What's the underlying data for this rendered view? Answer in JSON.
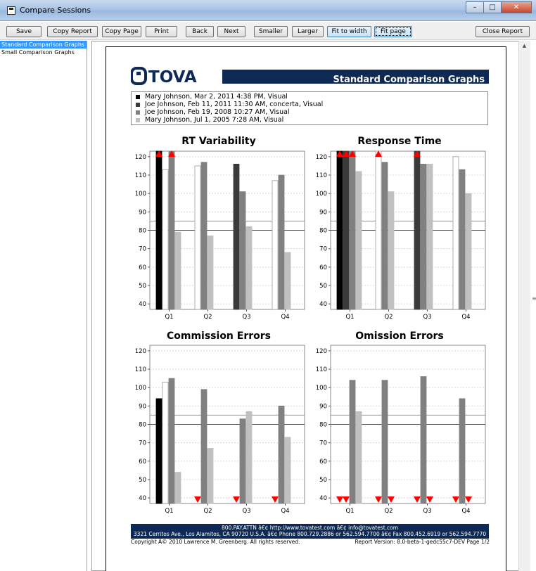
{
  "window": {
    "title": "Compare Sessions",
    "controls": {
      "minimize": "–",
      "maximize": "□",
      "close": "✕"
    }
  },
  "toolbar": {
    "buttons": [
      {
        "label": "Save"
      },
      {
        "label": "Copy Report"
      },
      {
        "label": "Copy Page"
      },
      {
        "label": "Print"
      },
      {
        "label": "Back"
      },
      {
        "label": "Next"
      },
      {
        "label": "Smaller"
      },
      {
        "label": "Larger"
      },
      {
        "label": "Fit to width"
      },
      {
        "label": "Fit page"
      },
      {
        "label": "Close Report"
      }
    ]
  },
  "sidebar": {
    "items": [
      {
        "label": "Standard Comparison Graphs",
        "selected": true
      },
      {
        "label": "Small Comparison Graphs",
        "selected": false
      }
    ]
  },
  "report": {
    "brand": "TOVA",
    "title": "Standard Comparison Graphs",
    "legend": [
      {
        "label": "Mary Johnson, Mar 2, 2011 4:38 PM, Visual",
        "color": "#000000"
      },
      {
        "label": "Joe Johnson, Feb 11, 2011 11:30 AM, concerta, Visual",
        "color": "#3a3a3a"
      },
      {
        "label": "Joe Johnson, Feb 19, 2008 10:27 AM, Visual",
        "color": "#808080"
      },
      {
        "label": "Mary Johnson, Jul 1, 2005 7:28 AM, Visual",
        "color": "#c0c0c0"
      }
    ],
    "footer": {
      "line1": "800.PAY.ATTN â€¢ http://www.tovatest.com â€¢ info@tovatest.com",
      "line2": "3321 Cerritos Ave., Los Alamitos, CA 90720 U.S.A. â€¢ Phone 800.729.2886 or 562.594.7700 â€¢ Fax 800.452.6919 or 562.594.7770",
      "copyright": "Copyright Â© 2010 Lawrence M. Greenberg. All rights reserved.",
      "version": "Report Version: 8.0-beta-1-gedc55c7-DEV   Page 1/2"
    }
  },
  "chart_data": [
    {
      "type": "bar",
      "title": "RT Variability",
      "categories": [
        "Q1",
        "Q2",
        "Q3",
        "Q4"
      ],
      "ylim": [
        37,
        123
      ],
      "yticks": [
        40,
        50,
        60,
        70,
        80,
        90,
        100,
        110,
        120
      ],
      "reference_lines": [
        80,
        85
      ],
      "series": [
        {
          "color": "#000000",
          "values": [
            123,
            null,
            null,
            null
          ],
          "overflow": [
            true,
            false,
            false,
            false
          ]
        },
        {
          "color": "#ffffff",
          "values": [
            113,
            115,
            null,
            107
          ],
          "overflow": [
            false,
            false,
            false,
            false
          ]
        },
        {
          "color": "#3a3a3a",
          "values": [
            null,
            null,
            116,
            null
          ],
          "overflow": [
            false,
            false,
            false,
            false
          ]
        },
        {
          "color": "#808080",
          "values": [
            123,
            117,
            101,
            110
          ],
          "overflow": [
            true,
            false,
            false,
            false
          ]
        },
        {
          "color": "#c0c0c0",
          "values": [
            79,
            77,
            82,
            68
          ],
          "overflow": [
            false,
            false,
            false,
            false
          ]
        }
      ]
    },
    {
      "type": "bar",
      "title": "Response Time",
      "categories": [
        "Q1",
        "Q2",
        "Q3",
        "Q4"
      ],
      "ylim": [
        37,
        123
      ],
      "yticks": [
        40,
        50,
        60,
        70,
        80,
        90,
        100,
        110,
        120
      ],
      "reference_lines": [
        80,
        85
      ],
      "series": [
        {
          "color": "#000000",
          "values": [
            123,
            null,
            null,
            null
          ],
          "overflow": [
            true,
            false,
            false,
            false
          ]
        },
        {
          "color": "#ffffff",
          "values": [
            null,
            123,
            null,
            120
          ],
          "overflow": [
            false,
            true,
            false,
            false
          ]
        },
        {
          "color": "#3a3a3a",
          "values": [
            123,
            null,
            123,
            null
          ],
          "overflow": [
            true,
            false,
            true,
            false
          ]
        },
        {
          "color": "#808080",
          "values": [
            123,
            117,
            116,
            113
          ],
          "overflow": [
            true,
            false,
            false,
            false
          ]
        },
        {
          "color": "#c0c0c0",
          "values": [
            112,
            101,
            116,
            100
          ],
          "overflow": [
            false,
            false,
            false,
            false
          ]
        }
      ]
    },
    {
      "type": "bar",
      "title": "Commission Errors",
      "categories": [
        "Q1",
        "Q2",
        "Q3",
        "Q4"
      ],
      "ylim": [
        37,
        123
      ],
      "yticks": [
        40,
        50,
        60,
        70,
        80,
        90,
        100,
        110,
        120
      ],
      "reference_lines": [
        80,
        85
      ],
      "series": [
        {
          "color": "#000000",
          "values": [
            94,
            null,
            null,
            null
          ],
          "underflow": [
            false,
            false,
            false,
            false
          ]
        },
        {
          "color": "#ffffff",
          "values": [
            103,
            null,
            null,
            null
          ],
          "underflow": [
            false,
            false,
            false,
            false
          ]
        },
        {
          "color": "#3a3a3a",
          "values": [
            null,
            37,
            37,
            37
          ],
          "underflow": [
            false,
            true,
            true,
            true
          ]
        },
        {
          "color": "#808080",
          "values": [
            105,
            99,
            83,
            90
          ],
          "underflow": [
            false,
            false,
            false,
            false
          ]
        },
        {
          "color": "#c0c0c0",
          "values": [
            54,
            67,
            87,
            73
          ],
          "underflow": [
            false,
            false,
            false,
            false
          ]
        }
      ]
    },
    {
      "type": "bar",
      "title": "Omission Errors",
      "categories": [
        "Q1",
        "Q2",
        "Q3",
        "Q4"
      ],
      "ylim": [
        37,
        123
      ],
      "yticks": [
        40,
        50,
        60,
        70,
        80,
        90,
        100,
        110,
        120
      ],
      "reference_lines": [
        80,
        85
      ],
      "series": [
        {
          "color": "#000000",
          "values": [
            37,
            null,
            null,
            null
          ],
          "underflow": [
            true,
            false,
            false,
            false
          ]
        },
        {
          "color": "#3a3a3a",
          "values": [
            37,
            37,
            37,
            37
          ],
          "underflow": [
            true,
            true,
            true,
            true
          ]
        },
        {
          "color": "#808080",
          "values": [
            104,
            104,
            106,
            94
          ],
          "underflow": [
            false,
            false,
            false,
            false
          ]
        },
        {
          "color": "#c0c0c0",
          "values": [
            87,
            37,
            37,
            37
          ],
          "underflow": [
            false,
            true,
            true,
            true
          ]
        }
      ]
    }
  ]
}
